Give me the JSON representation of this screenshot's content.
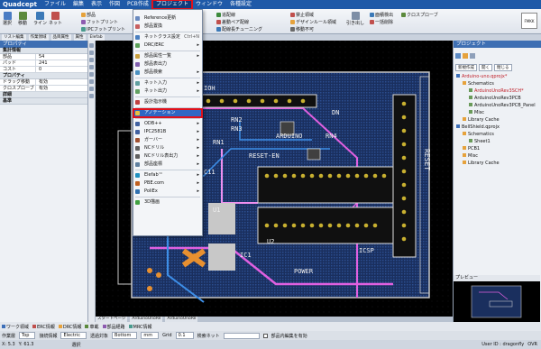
{
  "app": {
    "logo": "Quadcept"
  },
  "menus": [
    "ファイル",
    "編集",
    "表示",
    "作図",
    "PCB作成",
    "プロジェクト",
    "ウィンドウ",
    "各種設定"
  ],
  "ribbon": {
    "big": [
      "選択",
      "移動",
      "ライン",
      "ネット",
      "コピー",
      "部品",
      "貼り付け"
    ],
    "group1": [
      "部品",
      "フットプリント",
      "IPCフットプリント"
    ],
    "group2": [
      "追配線",
      "差動ペア配線",
      "配線長チューニング"
    ],
    "group3": [
      "禁止領域",
      "デザインルール領域",
      "移動不可"
    ],
    "group4": [
      "面積検出",
      "一括削除",
      "クロスプローブ"
    ],
    "right_btn": "引き出し"
  },
  "tabs": [
    "リスト編集",
    "作業領域",
    "品目属性",
    "属性",
    "Elefab"
  ],
  "left": {
    "title": "プロパティ",
    "sec1": "集計情報",
    "rows": [
      {
        "k": "部品",
        "v": "54"
      },
      {
        "k": "パッド",
        "v": "241"
      },
      {
        "k": "コスト",
        "v": "0"
      }
    ],
    "sec2": "プロパティ",
    "rows2": [
      {
        "k": "ドラッグ移動",
        "v": "有効"
      },
      {
        "k": "クロスプローブ",
        "v": "有効"
      }
    ],
    "sec3": "詳細",
    "sec4": "基準"
  },
  "dropdown": [
    {
      "label": "",
      "type": "blank"
    },
    {
      "label": "Reference更新",
      "icon": "#6a8ac0"
    },
    {
      "label": "部品置換",
      "icon": "#c86060"
    },
    {
      "type": "sep"
    },
    {
      "label": "ネットクラス設定",
      "shortcut": "Ctrl+N",
      "icon": "#4a7fc0"
    },
    {
      "label": "DRC/ERC",
      "arrow": true,
      "icon": "#5aa05a"
    },
    {
      "type": "sep"
    },
    {
      "label": "部品属性一覧",
      "arrow": true,
      "icon": "#c8a040"
    },
    {
      "label": "部品表出力",
      "icon": "#8060b0"
    },
    {
      "label": "部品検索",
      "arrow": true,
      "icon": "#4a90c0"
    },
    {
      "type": "sep"
    },
    {
      "label": "ネット入力",
      "arrow": true,
      "icon": "#60a0a0"
    },
    {
      "label": "ネット出力",
      "arrow": true,
      "icon": "#60a060"
    },
    {
      "type": "sep"
    },
    {
      "label": "設計指示機",
      "icon": "#c04040"
    },
    {
      "type": "sep"
    },
    {
      "label": "アノテーション",
      "hl": true,
      "icon": "#e8c040"
    },
    {
      "type": "sep"
    },
    {
      "label": "ODB++",
      "arrow": true,
      "icon": "#4060a0"
    },
    {
      "label": "IPC2581B",
      "arrow": true,
      "icon": "#4060a0"
    },
    {
      "label": "ガーバー",
      "arrow": true,
      "icon": "#a05030"
    },
    {
      "label": "NCドリル",
      "arrow": true,
      "icon": "#606060"
    },
    {
      "label": "NCドリル表出力",
      "arrow": true,
      "icon": "#606060"
    },
    {
      "label": "部品座標",
      "arrow": true,
      "icon": "#6080a0"
    },
    {
      "type": "sep"
    },
    {
      "label": "Elefab™",
      "arrow": true,
      "icon": "#2090c0"
    },
    {
      "label": "PBE.com",
      "arrow": true,
      "icon": "#c06020"
    },
    {
      "label": "PoliEx",
      "arrow": true,
      "icon": "#3070b0"
    },
    {
      "type": "sep"
    },
    {
      "label": "3D描画",
      "icon": "#40a040"
    }
  ],
  "right": {
    "title": "プロジェクト",
    "btns": [
      "新規作成",
      "開く",
      "閉じる"
    ],
    "tree": [
      {
        "t": "Arduino-uno.qprojx*",
        "lvl": 0,
        "red": true
      },
      {
        "t": "Schematics",
        "lvl": 1
      },
      {
        "t": "ArduinoUnoRev3SCH*",
        "lvl": 2,
        "red": true
      },
      {
        "t": "ArduinoUnoRev3PCB",
        "lvl": 2
      },
      {
        "t": "ArduinoUnoRev3PCB_Panel",
        "lvl": 2
      },
      {
        "t": "Misc",
        "lvl": 2
      },
      {
        "t": "Library Cache",
        "lvl": 1
      },
      {
        "t": "BellShield.qprojx",
        "lvl": 0
      },
      {
        "t": "Schematics",
        "lvl": 1
      },
      {
        "t": "Sheet1",
        "lvl": 2
      },
      {
        "t": "PCB1",
        "lvl": 1
      },
      {
        "t": "Misc",
        "lvl": 1
      },
      {
        "t": "Library Cache",
        "lvl": 1
      }
    ],
    "preview_title": "プレビュー"
  },
  "bottom_tabs": [
    "スタートページ",
    "ArduinoUnoRe",
    "ArduinoUnoRe"
  ],
  "legend": [
    "ワーク領域",
    "ERC情報",
    "DRC情報",
    "車載",
    "部品経路",
    "MRC情報"
  ],
  "toolbar2": {
    "layer_label": "作業層",
    "layer": "Top",
    "net_label": "接続情報",
    "net": "Electric",
    "layer2_label": "透過対象",
    "layer2": "Bottom",
    "unit": "mm",
    "grid_label": "Grid",
    "grid": "0.1",
    "search_label": "検索ネット",
    "check": "部品内編集を有効"
  },
  "status": {
    "x": "X: 5.3",
    "y": "Y: 61.3",
    "mode": "選択",
    "user": "User ID : dragonfly",
    "ovr": "OVR"
  },
  "board": {
    "title": "ARDUINO",
    "reset": "RESET",
    "reset_en": "RESET-EN",
    "power": "POWER",
    "icsp": "ICSP",
    "ioh": "IOH",
    "labels": [
      "RN2",
      "RN3",
      "RN4",
      "RN1",
      "DN",
      "U1",
      "U2",
      "IC1",
      "C11"
    ]
  }
}
